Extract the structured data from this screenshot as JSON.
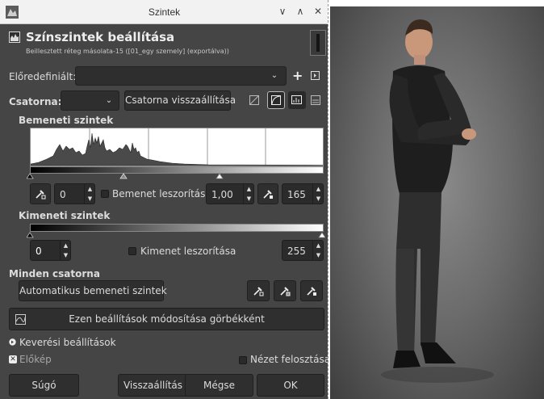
{
  "window": {
    "title": "Szintek",
    "controls": [
      "∨",
      "∧",
      "✕"
    ]
  },
  "header": {
    "title": "Színszintek beállítása",
    "subtitle": "Beillesztett réteg másolata-15 ([01_egy szemely] (exportálva))"
  },
  "presets": {
    "label": "Előredefiniált:",
    "value": ""
  },
  "channel": {
    "label": "Csatorna:",
    "value": "",
    "reset_label": "Csatorna visszaállítása"
  },
  "input_levels": {
    "heading": "Bemeneti szintek",
    "low_value": "0",
    "clamp_label": "Bemenet leszorítása",
    "gamma_value": "1,00",
    "high_value": "165"
  },
  "output_levels": {
    "heading": "Kimeneti szintek",
    "low_value": "0",
    "clamp_label": "Kimenet leszorítása",
    "high_value": "255"
  },
  "all_channels": {
    "heading": "Minden csatorna",
    "auto_label": "Automatikus bemeneti szintek"
  },
  "curves_button_label": "Ezen beállítások módosítása görbékként",
  "blend_label": "Keverési beállítások",
  "preview_label": "Előkép",
  "split_view_label": "Nézet felosztása",
  "footer": {
    "help": "Súgó",
    "reset": "Visszaállítás",
    "cancel": "Mégse",
    "ok": "OK"
  },
  "colors": {
    "dialog_bg": "#454545",
    "field_bg": "#2e2e2e",
    "titlebar_bg": "#f2f2f2",
    "text": "#dcdcdc"
  }
}
